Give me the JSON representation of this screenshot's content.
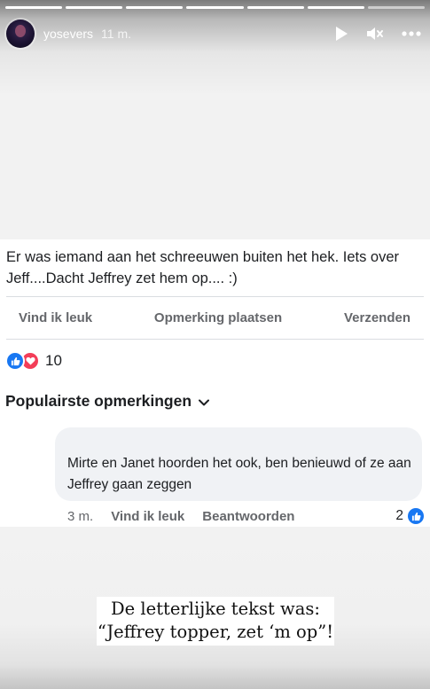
{
  "story": {
    "segments": 7,
    "completed_segments": 6,
    "username": "yosevers",
    "time": "11 m."
  },
  "post": {
    "text": "Er was iemand aan het schreeuwen buiten het hek. Iets over Jeff....Dacht Jeffrey zet hem op.... :)",
    "actions": {
      "like": "Vind ik leuk",
      "comment": "Opmerking plaatsen",
      "share": "Verzenden"
    },
    "reaction_count": "10",
    "sort_label": "Populairste opmerkingen"
  },
  "comment": {
    "text": "Mirte en Janet hoorden het ook, ben benieuwd of ze aan Jeffrey gaan zeggen",
    "age": "3 m.",
    "like_label": "Vind ik leuk",
    "reply_label": "Beantwoorden",
    "likes": "2"
  },
  "caption": {
    "line1": "De letterlijke tekst was:",
    "line2": "“Jeffrey topper, zet ‘m op”!"
  },
  "colors": {
    "facebook_blue": "#1877f2",
    "love_red": "#f33e58",
    "muted_text": "#65676b"
  }
}
